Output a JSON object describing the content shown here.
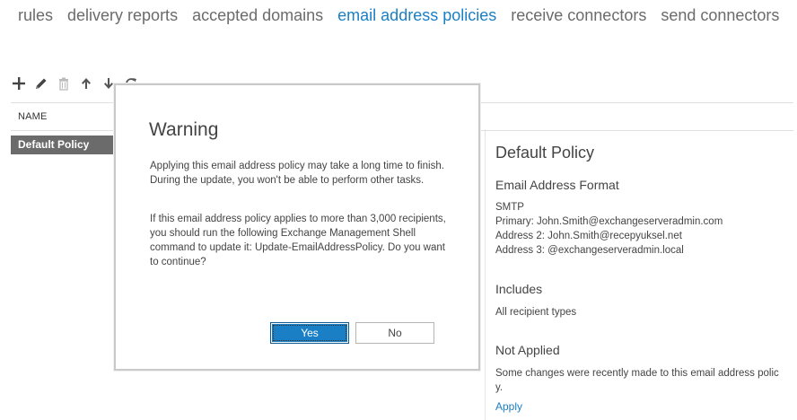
{
  "nav": {
    "tabs": [
      {
        "label": "rules",
        "active": false
      },
      {
        "label": "delivery reports",
        "active": false
      },
      {
        "label": "accepted domains",
        "active": false
      },
      {
        "label": "email address policies",
        "active": true
      },
      {
        "label": "receive connectors",
        "active": false
      },
      {
        "label": "send connectors",
        "active": false
      }
    ]
  },
  "toolbar": {
    "icons": [
      "add-icon",
      "edit-icon",
      "delete-icon",
      "move-up-icon",
      "move-down-icon",
      "refresh-icon"
    ]
  },
  "list": {
    "column_name": "NAME",
    "rows": [
      {
        "name": "Default Policy",
        "selected": true
      }
    ]
  },
  "details": {
    "title": "Default Policy",
    "email_format_heading": "Email Address Format",
    "smtp_label": "SMTP",
    "primary": "Primary: John.Smith@exchangeserveradmin.com",
    "address2": "Address 2: John.Smith@recepyuksel.net",
    "address3": "Address 3: @exchangeserveradmin.local",
    "includes_heading": "Includes",
    "includes_value": "All recipient types",
    "not_applied_heading": "Not Applied",
    "not_applied_line1": "Some changes were recently made to this email address polic",
    "not_applied_line2": "y.",
    "apply_link": "Apply"
  },
  "dialog": {
    "title": "Warning",
    "para1": "Applying this email address policy may take a long time to finish. During the update, you won't be able to perform other tasks.",
    "para2": "If this email address policy applies to more than 3,000 recipients, you should run the following Exchange Management Shell command to update it: Update-EmailAddressPolicy. Do you want to continue?",
    "yes_label": "Yes",
    "no_label": "No"
  },
  "colors": {
    "accent": "#1a7fc4",
    "selected_row": "#6b6b6b",
    "nav_inactive": "#6b6b6b"
  }
}
